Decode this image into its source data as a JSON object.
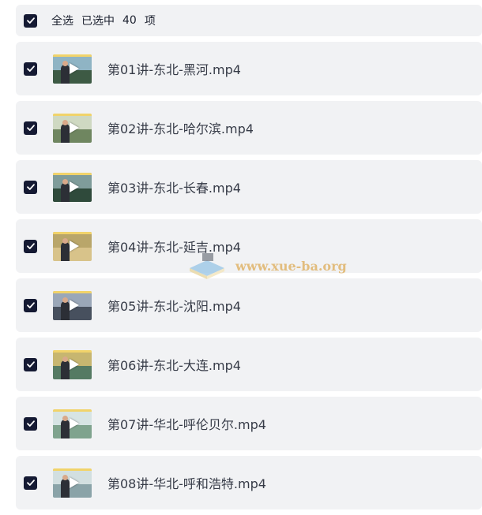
{
  "select_all": {
    "checked": true,
    "label": "全选",
    "selected_prefix": "已选中",
    "selected_count": "40",
    "selected_suffix": "项"
  },
  "files": [
    {
      "name": "第01讲-东北-黑河.mp4",
      "checked": true,
      "thumb": {
        "sky": "#8fb4c4",
        "ground": "#3d5a44",
        "icon": "video-thumbnail-icon"
      }
    },
    {
      "name": "第02讲-东北-哈尔滨.mp4",
      "checked": true,
      "thumb": {
        "sky": "#cfd9c2",
        "ground": "#6f8660",
        "icon": "video-thumbnail-icon"
      }
    },
    {
      "name": "第03讲-东北-长春.mp4",
      "checked": true,
      "thumb": {
        "sky": "#7f9c9a",
        "ground": "#2f4a3b",
        "icon": "video-thumbnail-icon"
      }
    },
    {
      "name": "第04讲-东北-延吉.mp4",
      "checked": true,
      "thumb": {
        "sky": "#b9a66a",
        "ground": "#d8c38a",
        "icon": "video-thumbnail-icon"
      }
    },
    {
      "name": "第05讲-东北-沈阳.mp4",
      "checked": true,
      "thumb": {
        "sky": "#9aa7b8",
        "ground": "#47505e",
        "icon": "video-thumbnail-icon"
      }
    },
    {
      "name": "第06讲-东北-大连.mp4",
      "checked": true,
      "thumb": {
        "sky": "#c7b670",
        "ground": "#557a63",
        "icon": "video-thumbnail-icon"
      }
    },
    {
      "name": "第07讲-华北-呼伦贝尔.mp4",
      "checked": true,
      "thumb": {
        "sky": "#d7e4e4",
        "ground": "#7fa38e",
        "icon": "video-thumbnail-icon"
      }
    },
    {
      "name": "第08讲-华北-呼和浩特.mp4",
      "checked": true,
      "thumb": {
        "sky": "#d2dfe0",
        "ground": "#8aa3a8",
        "icon": "video-thumbnail-icon"
      }
    }
  ],
  "watermark": {
    "text": "www.xue-ba.org",
    "icon": "book-logo-icon"
  },
  "colors": {
    "row_bg": "#f1f2f4",
    "checkbox_bg": "#151a33",
    "text": "#363b47",
    "watermark": "#e0b46a"
  }
}
